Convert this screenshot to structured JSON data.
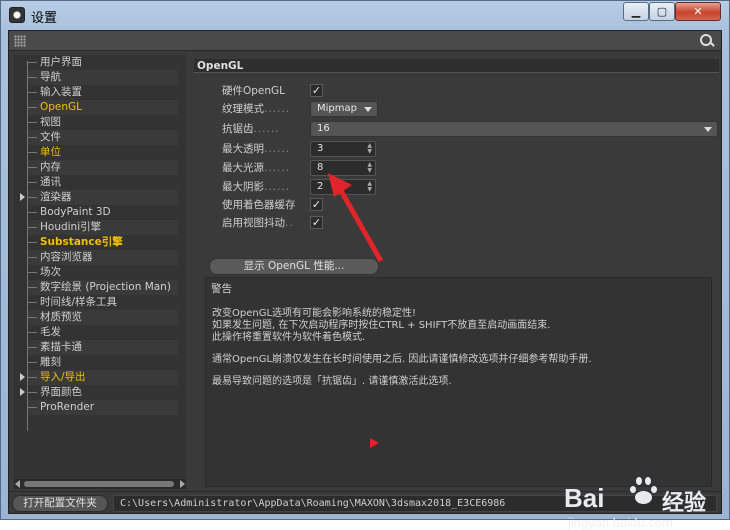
{
  "window": {
    "title": "设置",
    "min_glyph": "▁",
    "max_glyph": "▢",
    "close_glyph": "✕"
  },
  "sidebar": {
    "items": [
      {
        "label": "用户界面",
        "style": "normal"
      },
      {
        "label": "导航",
        "style": "normal"
      },
      {
        "label": "输入装置",
        "style": "normal"
      },
      {
        "label": "OpenGL",
        "style": "selected"
      },
      {
        "label": "视图",
        "style": "normal"
      },
      {
        "label": "文件",
        "style": "normal"
      },
      {
        "label": "单位",
        "style": "highlight"
      },
      {
        "label": "内存",
        "style": "normal"
      },
      {
        "label": "通讯",
        "style": "normal"
      },
      {
        "label": "渲染器",
        "style": "normal",
        "expandable": true
      },
      {
        "label": "BodyPaint 3D",
        "style": "normal"
      },
      {
        "label": "Houdini引擎",
        "style": "normal"
      },
      {
        "label": "Substance引擎",
        "style": "highlight-bold"
      },
      {
        "label": "内容浏览器",
        "style": "normal"
      },
      {
        "label": "场次",
        "style": "normal"
      },
      {
        "label": "数字绘景 (Projection Man)",
        "style": "normal"
      },
      {
        "label": "时间线/样条工具",
        "style": "normal"
      },
      {
        "label": "材质预览",
        "style": "normal"
      },
      {
        "label": "毛发",
        "style": "normal"
      },
      {
        "label": "素描卡通",
        "style": "normal"
      },
      {
        "label": "雕刻",
        "style": "normal"
      },
      {
        "label": "导入/导出",
        "style": "highlight",
        "expandable": true
      },
      {
        "label": "界面颜色",
        "style": "normal",
        "expandable": true
      },
      {
        "label": "ProRender",
        "style": "normal"
      }
    ]
  },
  "opengl": {
    "header": "OpenGL",
    "hardware_label": "硬件OpenGL",
    "hardware_checked": "✓",
    "texture_mode_label": "纹理模式",
    "texture_mode_value": "Mipmap",
    "antialias_label": "抗锯齿",
    "antialias_value": "16",
    "max_transparency_label": "最大透明",
    "max_transparency_value": "3",
    "max_lights_label": "最大光源",
    "max_lights_value": "8",
    "max_shadows_label": "最大阴影",
    "max_shadows_value": "2",
    "use_shader_cache_label": "使用着色器缓存",
    "use_shader_cache_checked": "✓",
    "enable_viewport_jitter_label": "启用视图抖动",
    "enable_viewport_jitter_checked": "✓",
    "dots": "......",
    "spin_arrows": "▲\n▼",
    "perf_button": "显示 OpenGL 性能..."
  },
  "warning": {
    "title": "警告",
    "line1": "改变OpenGL选项有可能会影响系统的稳定性!",
    "line2": "如果发生问题, 在下次启动程序时按住CTRL + SHIFT不放直至启动画面结束.",
    "line3": "此操作将重置软件为软件着色模式.",
    "line4": "通常OpenGL崩溃仅发生在长时间使用之后. 因此请谨慎修改选项并仔细参考帮助手册.",
    "line5": "最易导致问题的选项是「抗锯齿」. 请谨慎激活此选项."
  },
  "bottom": {
    "open_folder_button": "打开配置文件夹",
    "path": "C:\\Users\\Administrator\\AppData\\Roaming\\MAXON\\3dsmax2018_E3CE6986"
  },
  "watermark": {
    "brand": "Bai",
    "brand_suffix": "经验",
    "url": "jingyan.baidu.com"
  },
  "colors": {
    "highlight": "#f0c000",
    "annotation_red": "#e0242a",
    "panel_bg": "#3a3a3a"
  }
}
